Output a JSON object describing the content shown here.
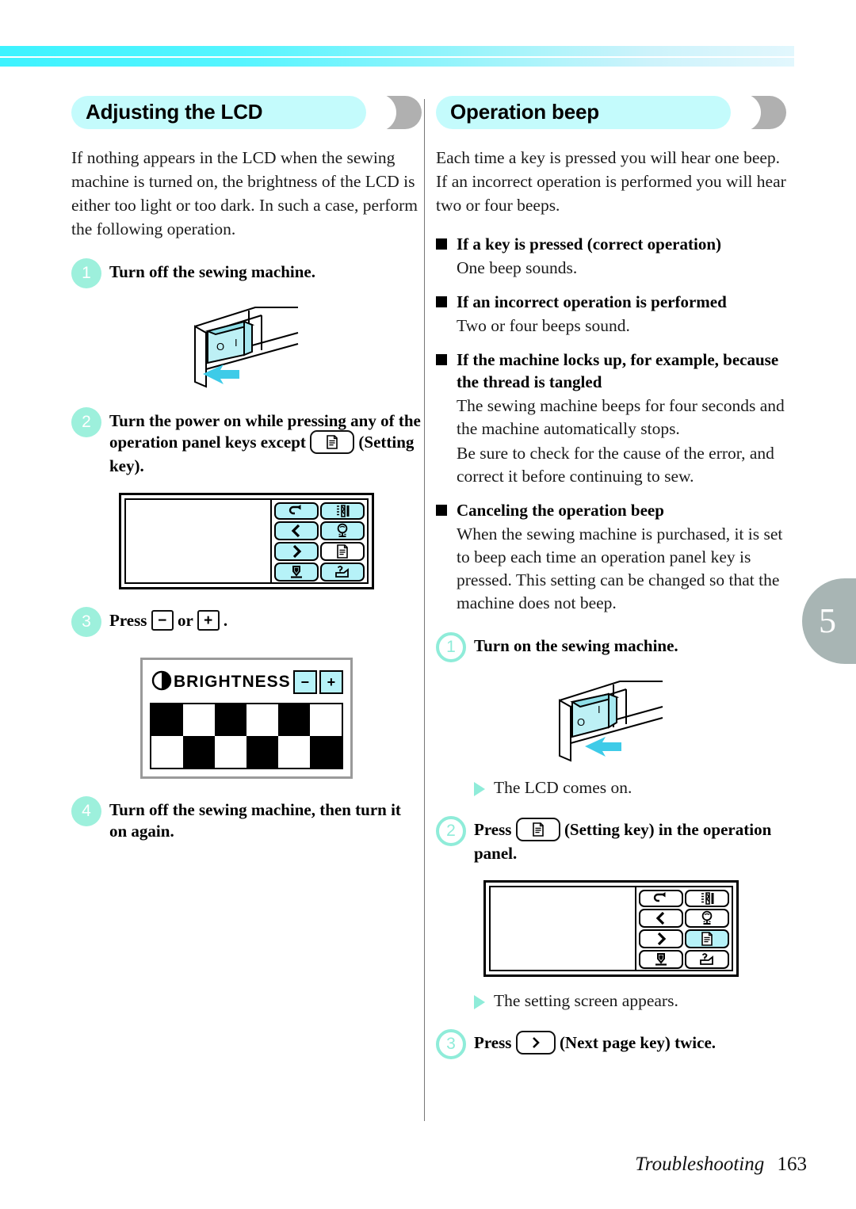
{
  "page": {
    "side_tab_number": "5",
    "footer_chapter": "Troubleshooting",
    "footer_page": "163",
    "accent_cyan": "#c4fbfc",
    "accent_mint": "#8fecd9",
    "key_fill": "#b6f2f8",
    "tab_gray": "#a8b5b4"
  },
  "left": {
    "title": "Adjusting the LCD",
    "intro": "If nothing appears in the LCD when the sewing machine is turned on, the brightness of the LCD is either too light or too dark. In such a case, perform the following operation.",
    "steps": [
      {
        "num": "1",
        "text": "Turn off the sewing machine."
      },
      {
        "num": "2",
        "text_before": "Turn the power on while pressing any of the operation panel keys except",
        "key": "setting-key",
        "text_after": "(Setting key)."
      },
      {
        "num": "3",
        "text_before": "Press",
        "key_minus": "−",
        "text_mid": "or",
        "key_plus": "+",
        "text_after": "."
      },
      {
        "num": "4",
        "text": "Turn off the sewing machine, then turn it on again."
      }
    ],
    "panel_keys": [
      {
        "name": "return-key",
        "glyph": "return",
        "active": true
      },
      {
        "name": "stitch-width-key",
        "glyph": "stitch",
        "active": true
      },
      {
        "name": "previous-page-key",
        "glyph": "prev",
        "active": true
      },
      {
        "name": "presser-foot-key",
        "glyph": "foot",
        "active": true
      },
      {
        "name": "next-page-key",
        "glyph": "next",
        "active": true
      },
      {
        "name": "setting-key",
        "glyph": "setting",
        "active": false
      },
      {
        "name": "needle-down-key",
        "glyph": "needledown",
        "active": true
      },
      {
        "name": "help-key",
        "glyph": "help",
        "active": true
      }
    ],
    "lcd": {
      "title": "BRIGHTNESS",
      "minus_label": "−",
      "plus_label": "+",
      "checker_rows": [
        [
          1,
          0,
          1,
          0,
          1,
          0
        ],
        [
          0,
          1,
          0,
          1,
          0,
          1
        ]
      ]
    }
  },
  "right": {
    "title": "Operation beep",
    "intro": "Each time a key is pressed you will hear one beep. If an incorrect operation is performed you will hear two or four beeps.",
    "sections": [
      {
        "head": "If a key is pressed (correct operation)",
        "body": [
          "One beep sounds."
        ]
      },
      {
        "head": "If an incorrect operation is performed",
        "body": [
          "Two or four beeps sound."
        ]
      },
      {
        "head": "If the machine locks up, for example, because the thread is tangled",
        "body": [
          "The sewing machine beeps for four seconds and the machine automatically stops.",
          "Be sure to check for the cause of the error, and correct it before continuing to sew."
        ]
      },
      {
        "head": "Canceling the operation beep",
        "body": [
          "When the sewing machine is purchased, it is set to beep each time an operation panel key is pressed. This setting can be changed so that the machine does not beep."
        ]
      }
    ],
    "steps": [
      {
        "num": "1",
        "text": "Turn on the sewing machine."
      },
      {
        "num": "2",
        "text_before": "Press",
        "key": "setting-key",
        "text_after": "(Setting key) in the operation panel."
      },
      {
        "num": "3",
        "text_before": "Press",
        "key": "next-page-key",
        "text_after": "(Next page key) twice."
      }
    ],
    "results": [
      "The LCD comes on.",
      "The setting screen appears."
    ],
    "panel_keys": [
      {
        "name": "return-key",
        "glyph": "return",
        "active": false
      },
      {
        "name": "stitch-width-key",
        "glyph": "stitch",
        "active": false
      },
      {
        "name": "previous-page-key",
        "glyph": "prev",
        "active": false
      },
      {
        "name": "presser-foot-key",
        "glyph": "foot",
        "active": false
      },
      {
        "name": "next-page-key",
        "glyph": "next",
        "active": false
      },
      {
        "name": "setting-key",
        "glyph": "setting",
        "active": true
      },
      {
        "name": "needle-down-key",
        "glyph": "needledown",
        "active": false
      },
      {
        "name": "help-key",
        "glyph": "help",
        "active": false
      }
    ]
  }
}
